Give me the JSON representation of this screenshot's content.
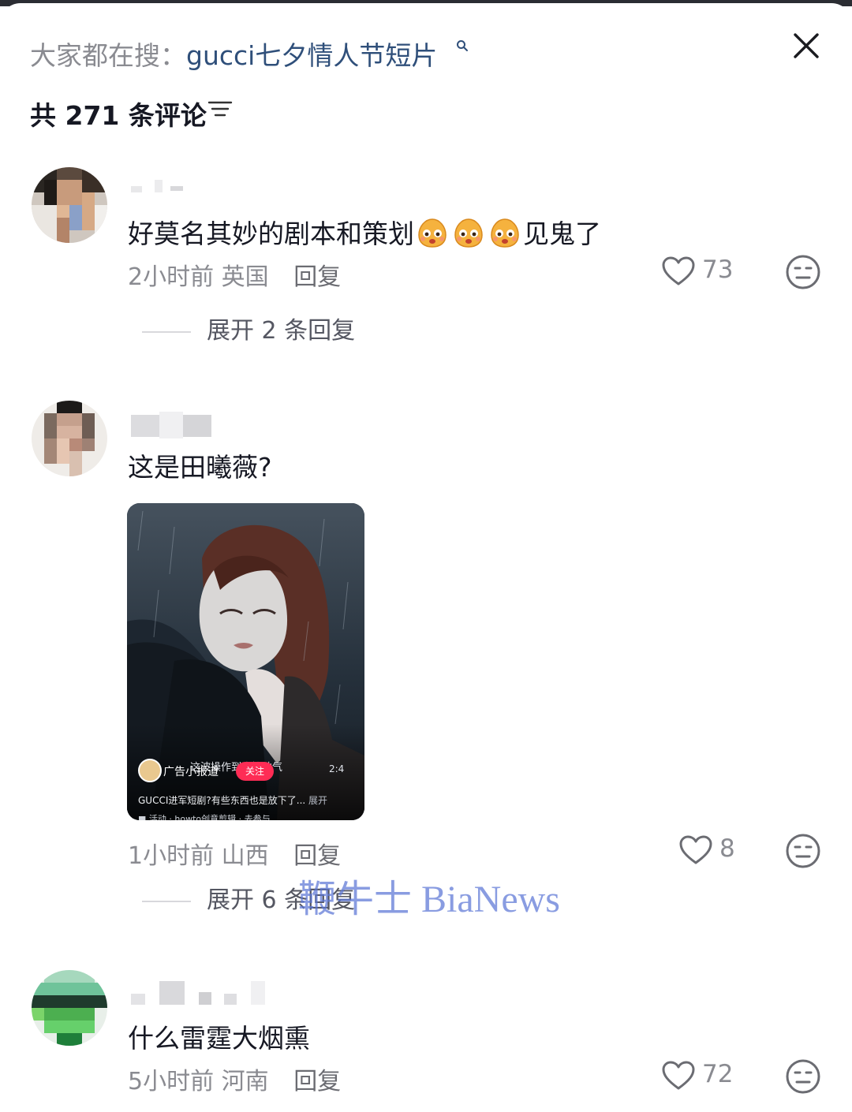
{
  "header": {
    "search_prefix": "大家都在搜：",
    "search_term": "gucci七夕情人节短片",
    "comment_count_label": "共 271 条评论"
  },
  "icons": {
    "close": "close-icon",
    "sort": "sort-icon",
    "search": "search-icon",
    "like": "heart-icon",
    "dislike": "dislike-face-icon"
  },
  "comments": [
    {
      "text": "好莫名其妙的剧本和策划",
      "text_suffix": "见鬼了",
      "emoji_count": 3,
      "time": "2小时前",
      "location": "英国",
      "reply_label": "回复",
      "likes": "73",
      "expand_label": "展开 2 条回复"
    },
    {
      "text": "这是田曦薇?",
      "time": "1小时前",
      "location": "山西",
      "reply_label": "回复",
      "likes": "8",
      "expand_label": "展开 6 条回复",
      "media": {
        "account": "广告小报道",
        "overlay_text": "这波操作到底接地气",
        "follow_label": "关注",
        "duration": "2:4",
        "caption": "GUCCI进军短剧?有些东西也是放下了...",
        "caption_more": "展开",
        "footer": "■ 活动 · howto创意剪辑 · 去参与"
      }
    },
    {
      "text": "什么雷霆大烟熏",
      "time": "5小时前",
      "location": "河南",
      "reply_label": "回复",
      "likes": "72"
    }
  ],
  "watermark": "鞭牛士 BiaNews",
  "colors": {
    "accent_link": "#2f4f7a",
    "muted_text": "#8a8b91",
    "follow_red": "#fe2c55",
    "watermark": "#5c76d6"
  }
}
